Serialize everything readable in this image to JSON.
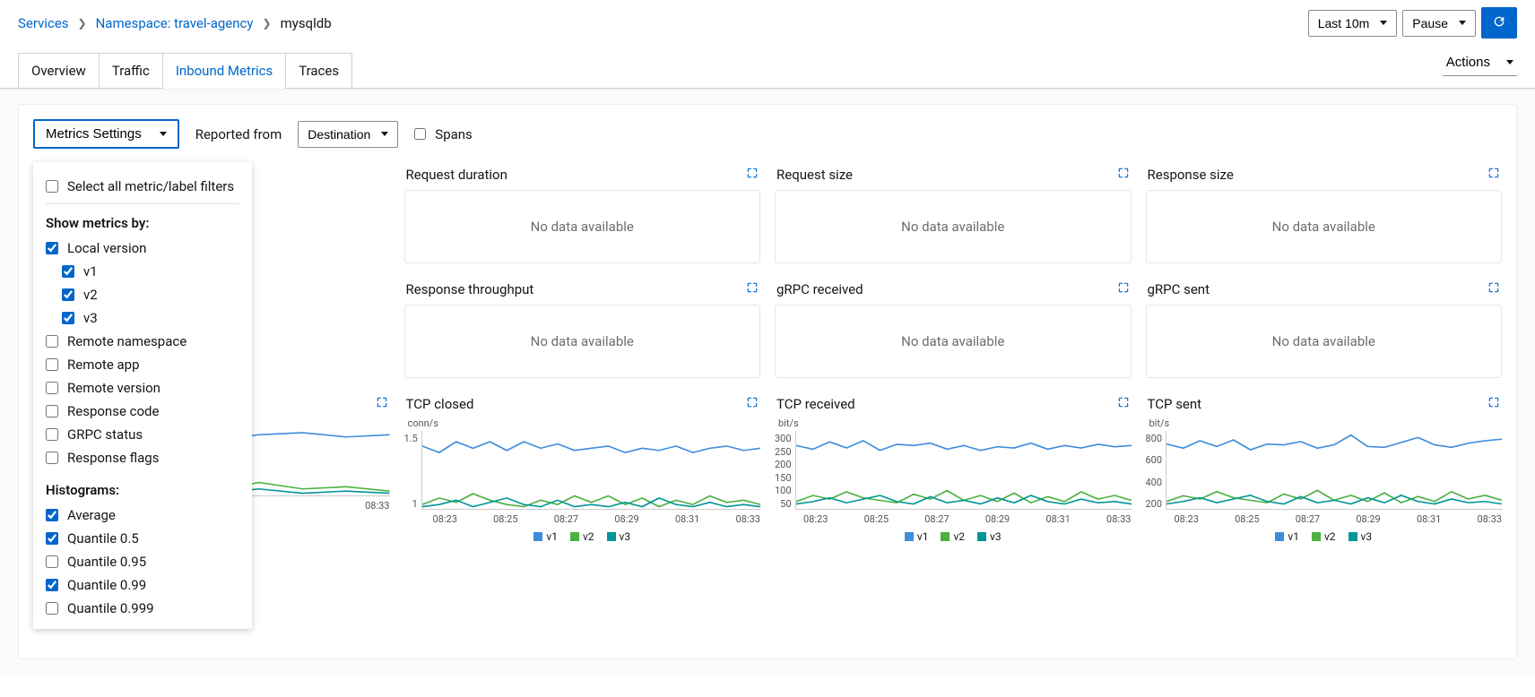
{
  "breadcrumb": {
    "services": "Services",
    "namespace": "Namespace: travel-agency",
    "current": "mysqldb"
  },
  "toolbar_top": {
    "time_range": "Last 10m",
    "pause": "Pause",
    "actions": "Actions"
  },
  "tabs": {
    "overview": "Overview",
    "traffic": "Traffic",
    "inbound": "Inbound Metrics",
    "traces": "Traces"
  },
  "controls": {
    "metrics_settings": "Metrics Settings",
    "reported_from": "Reported from",
    "reported_value": "Destination",
    "spans": "Spans"
  },
  "settings": {
    "select_all": "Select all metric/label filters",
    "show_by": "Show metrics by:",
    "local_version": "Local version",
    "v1": "v1",
    "v2": "v2",
    "v3": "v3",
    "remote_namespace": "Remote namespace",
    "remote_app": "Remote app",
    "remote_version": "Remote version",
    "response_code": "Response code",
    "grpc_status": "GRPC status",
    "response_flags": "Response flags",
    "histograms": "Histograms:",
    "average": "Average",
    "q05": "Quantile 0.5",
    "q095": "Quantile 0.95",
    "q099": "Quantile 0.99",
    "q0999": "Quantile 0.999"
  },
  "cards": {
    "no_data": "No data available",
    "request_duration": "Request duration",
    "request_size": "Request size",
    "response_size": "Response size",
    "response_throughput": "Response throughput",
    "grpc_received": "gRPC received",
    "grpc_sent": "gRPC sent",
    "tcp_closed": "TCP closed",
    "tcp_received": "TCP received",
    "tcp_sent": "TCP sent"
  },
  "legend": {
    "v1": "v1",
    "v2": "v2",
    "v3": "v3"
  },
  "colors": {
    "v1": "#3e8ddd",
    "v2": "#4cb140",
    "v3": "#009596"
  },
  "chart_data": [
    {
      "title": "TCP closed",
      "type": "line",
      "yunit": "conn/s",
      "x": [
        "08:23",
        "08:25",
        "08:27",
        "08:29",
        "08:31",
        "08:33"
      ],
      "ylim": [
        0,
        1.8
      ],
      "yticks": [
        1,
        1.5
      ],
      "series": [
        {
          "name": "v1",
          "values": [
            1.45,
            1.3,
            1.55,
            1.4,
            1.55,
            1.35,
            1.55,
            1.4,
            1.5,
            1.35,
            1.4,
            1.45,
            1.3,
            1.4,
            1.35,
            1.45,
            1.3,
            1.4,
            1.45,
            1.35,
            1.4
          ]
        },
        {
          "name": "v2",
          "values": [
            0.1,
            0.25,
            0.15,
            0.35,
            0.2,
            0.1,
            0.05,
            0.2,
            0.1,
            0.3,
            0.15,
            0.3,
            0.1,
            0.25,
            0.05,
            0.2,
            0.1,
            0.3,
            0.15,
            0.2,
            0.1
          ]
        },
        {
          "name": "v3",
          "values": [
            0.05,
            0.1,
            0.2,
            0.05,
            0.15,
            0.25,
            0.1,
            0.05,
            0.2,
            0.05,
            0.1,
            0.05,
            0.15,
            0.05,
            0.25,
            0.1,
            0.05,
            0.15,
            0.05,
            0.1,
            0.05
          ]
        }
      ]
    },
    {
      "title": "TCP received",
      "type": "line",
      "yunit": "bit/s",
      "x": [
        "08:23",
        "08:25",
        "08:27",
        "08:29",
        "08:31",
        "08:33"
      ],
      "ylim": [
        0,
        320
      ],
      "yticks": [
        50,
        100,
        150,
        200,
        250,
        300
      ],
      "series": [
        {
          "name": "v1",
          "values": [
            260,
            245,
            275,
            250,
            280,
            240,
            265,
            260,
            270,
            245,
            260,
            240,
            255,
            250,
            270,
            245,
            260,
            250,
            265,
            255,
            260
          ]
        },
        {
          "name": "v2",
          "values": [
            30,
            55,
            40,
            70,
            45,
            35,
            25,
            60,
            40,
            75,
            35,
            55,
            30,
            65,
            25,
            50,
            30,
            70,
            40,
            55,
            35
          ]
        },
        {
          "name": "v3",
          "values": [
            20,
            30,
            45,
            25,
            40,
            55,
            30,
            20,
            50,
            25,
            35,
            20,
            45,
            25,
            55,
            30,
            20,
            40,
            25,
            30,
            20
          ]
        }
      ]
    },
    {
      "title": "TCP sent",
      "type": "line",
      "yunit": "bit/s",
      "x": [
        "08:23",
        "08:25",
        "08:27",
        "08:29",
        "08:31",
        "08:33"
      ],
      "ylim": [
        0,
        950
      ],
      "yticks": [
        200,
        400,
        600,
        800
      ],
      "series": [
        {
          "name": "v1",
          "values": [
            790,
            740,
            830,
            760,
            840,
            720,
            790,
            780,
            820,
            740,
            780,
            900,
            760,
            750,
            810,
            870,
            780,
            750,
            800,
            830,
            850
          ]
        },
        {
          "name": "v2",
          "values": [
            90,
            160,
            120,
            210,
            135,
            105,
            75,
            180,
            120,
            225,
            105,
            165,
            90,
            195,
            75,
            150,
            90,
            210,
            120,
            165,
            105
          ]
        },
        {
          "name": "v3",
          "values": [
            60,
            90,
            135,
            75,
            120,
            165,
            90,
            60,
            150,
            75,
            105,
            60,
            135,
            75,
            165,
            90,
            60,
            120,
            75,
            90,
            60
          ]
        }
      ]
    }
  ]
}
